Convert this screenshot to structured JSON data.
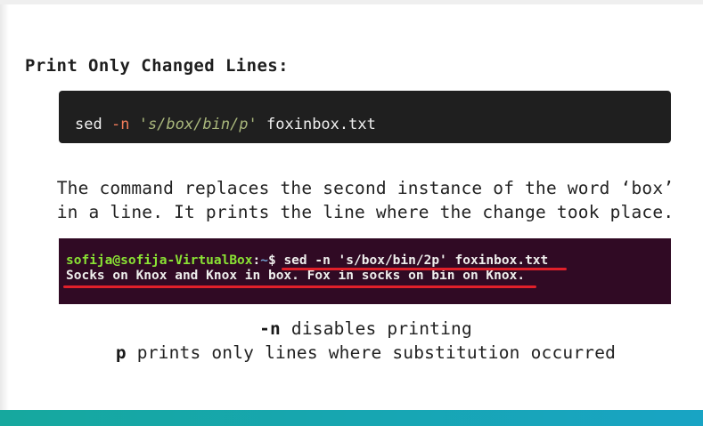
{
  "heading": "Print Only Changed Lines:",
  "code": {
    "command": "sed",
    "flag": "-n",
    "expression": "'s/box/bin/p'",
    "file": "foxinbox.txt"
  },
  "description": {
    "line1": "The command replaces the second instance of the word ‘box’",
    "line2": "in a line. It prints the line where the change took place."
  },
  "terminal": {
    "user_host": "sofija@sofija-VirtualBox",
    "colon": ":",
    "path": "~",
    "prompt": "$ ",
    "command": "sed -n 's/box/bin/2p' foxinbox.txt",
    "output": "Socks on Knox and Knox in box. Fox in socks on bin on Knox."
  },
  "explanations": [
    {
      "term": "-n",
      "text": " disables printing"
    },
    {
      "term": "p",
      "text": " prints only lines where substitution occurred"
    }
  ],
  "colors": {
    "underline": "#e0202a",
    "terminal_bg": "#300a24",
    "code_bg": "#1f1f1f",
    "bottom_bar": "#16a89e"
  }
}
